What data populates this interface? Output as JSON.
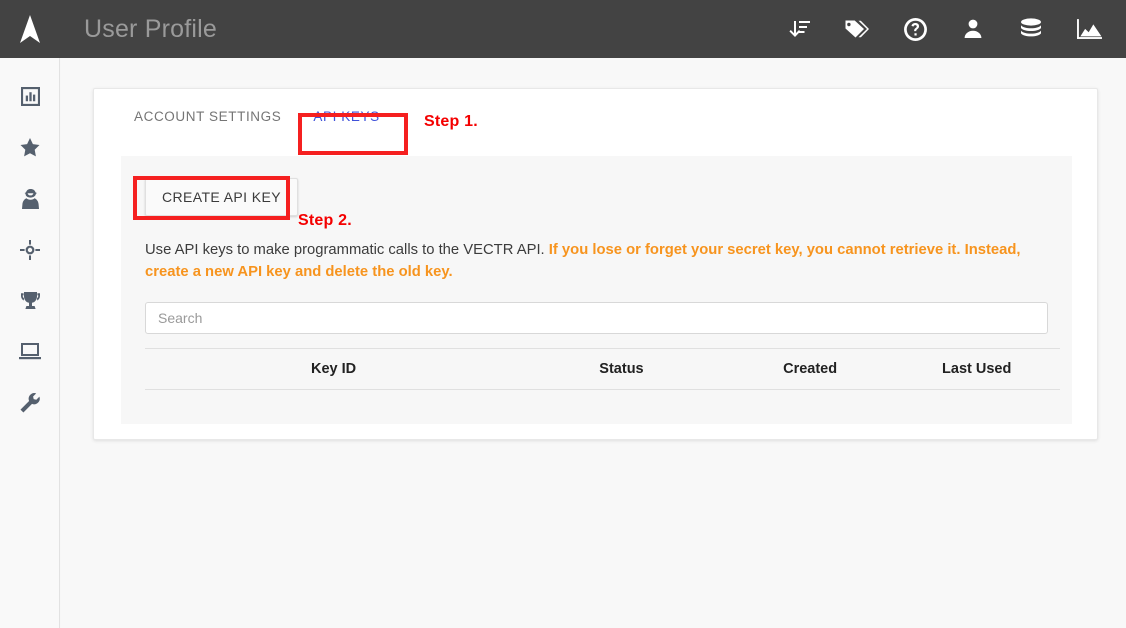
{
  "header": {
    "logo_icon": "navigation-arrow-logo",
    "title": "User Profile",
    "icons": [
      {
        "name": "sort-amount-desc-icon",
        "label": "Sort"
      },
      {
        "name": "tags-icon",
        "label": "Tags"
      },
      {
        "name": "help-circle-icon",
        "label": "Help"
      },
      {
        "name": "user-icon",
        "label": "User"
      },
      {
        "name": "database-icon",
        "label": "Database"
      },
      {
        "name": "area-chart-icon",
        "label": "Reports"
      }
    ]
  },
  "sidebar": {
    "items": [
      {
        "name": "sidebar-item-dashboard",
        "icon": "bar-chart-box-icon",
        "label": "Dashboard"
      },
      {
        "name": "sidebar-item-favorites",
        "icon": "star-icon",
        "label": "Favorites"
      },
      {
        "name": "sidebar-item-adversary",
        "icon": "user-secret-icon",
        "label": "Adversary"
      },
      {
        "name": "sidebar-item-targets",
        "icon": "crosshairs-icon",
        "label": "Targets"
      },
      {
        "name": "sidebar-item-campaigns",
        "icon": "trophy-icon",
        "label": "Campaigns"
      },
      {
        "name": "sidebar-item-environments",
        "icon": "laptop-icon",
        "label": "Environments"
      },
      {
        "name": "sidebar-item-settings",
        "icon": "wrench-icon",
        "label": "Settings"
      }
    ]
  },
  "tabs": [
    {
      "label": "ACCOUNT SETTINGS",
      "active": false
    },
    {
      "label": "API KEYS",
      "active": true
    }
  ],
  "panel": {
    "create_button": "CREATE API KEY",
    "description_plain": "Use API keys to make programmatic calls to the VECTR API. ",
    "description_warning": "If you lose or forget your secret key, you cannot retrieve it. Instead, create a new API key and delete the old key.",
    "search": {
      "value": "",
      "placeholder": "Search"
    },
    "table": {
      "columns": [
        "Key ID",
        "Status",
        "Created",
        "Last Used"
      ],
      "rows": []
    }
  },
  "annotations": [
    {
      "name": "step-1-label",
      "text": "Step 1.",
      "target": "api-keys-tab"
    },
    {
      "name": "step-2-label",
      "text": "Step 2.",
      "target": "create-api-key-button"
    }
  ],
  "colors": {
    "header_bg": "#434343",
    "accent_blue": "#3f51d9",
    "warning_orange": "#f7941e",
    "annotation_red": "#f52020",
    "panel_bg": "#f7f7f7"
  }
}
